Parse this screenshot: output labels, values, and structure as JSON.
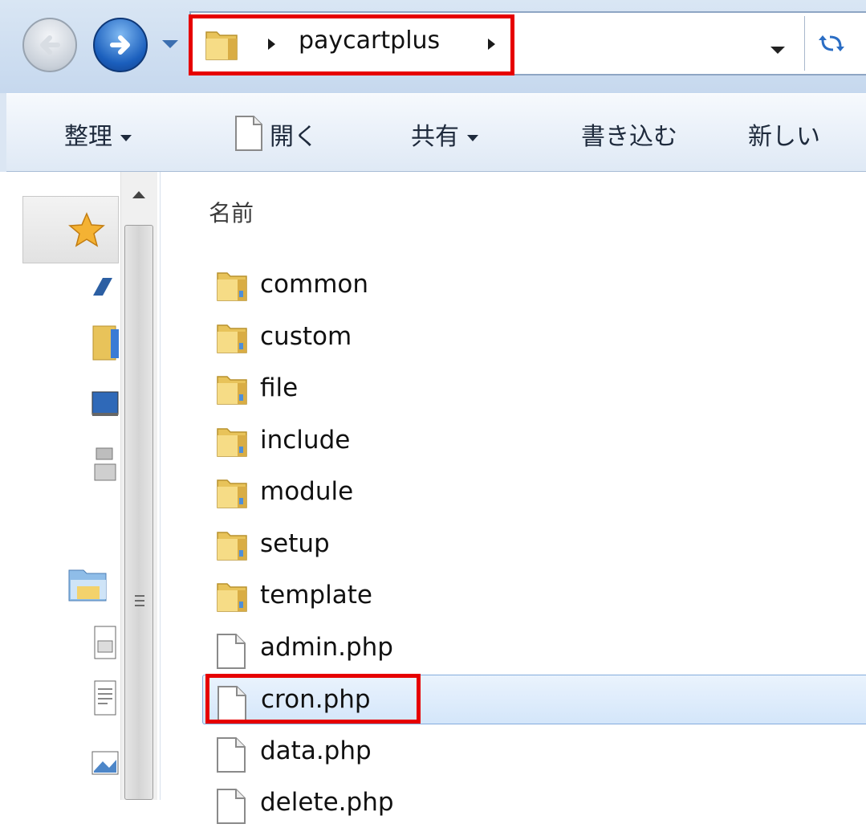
{
  "address_bar": {
    "path": "paycartplus"
  },
  "command_bar": {
    "organize": "整理",
    "open": "開く",
    "share": "共有",
    "burn": "書き込む",
    "new_folder": "新しい"
  },
  "file_list": {
    "column_header": "名前",
    "items": [
      {
        "name": "common",
        "type": "folder"
      },
      {
        "name": "custom",
        "type": "folder"
      },
      {
        "name": "file",
        "type": "folder"
      },
      {
        "name": "include",
        "type": "folder"
      },
      {
        "name": "module",
        "type": "folder"
      },
      {
        "name": "setup",
        "type": "folder"
      },
      {
        "name": "template",
        "type": "folder"
      },
      {
        "name": "admin.php",
        "type": "file"
      },
      {
        "name": "cron.php",
        "type": "file",
        "selected": true
      },
      {
        "name": "data.php",
        "type": "file"
      },
      {
        "name": "delete.php",
        "type": "file"
      }
    ]
  },
  "highlight_color": "#e60000",
  "selection_color": "#d4e6fa",
  "icons": {
    "nav": [
      "back-arrow-icon",
      "forward-arrow-icon",
      "folder-icon",
      "refresh-icon"
    ],
    "nav_pane": [
      "favorites-star-icon",
      "skydrive-cloud-icon",
      "downloads-folder-icon",
      "desktop-icon",
      "recent-places-icon",
      "libraries-icon",
      "documents-icon",
      "text-file-icon",
      "pictures-icon"
    ]
  }
}
